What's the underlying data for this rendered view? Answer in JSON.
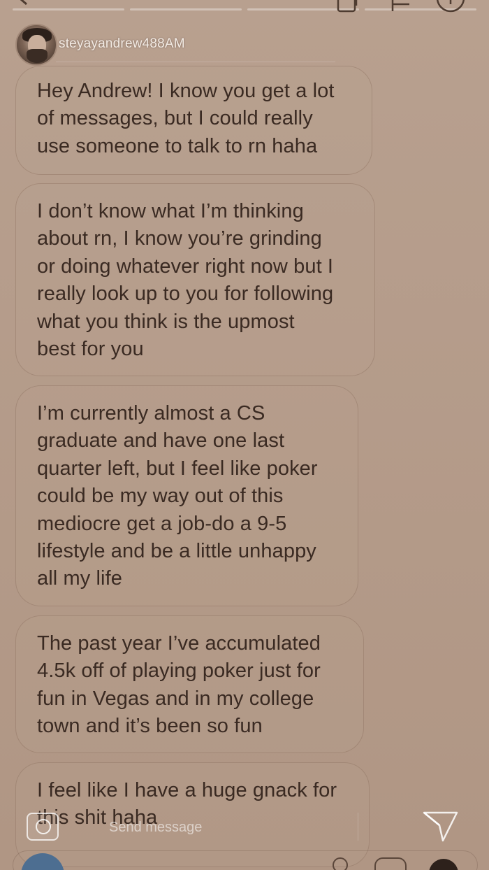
{
  "story": {
    "username": "steyayandrew488AM"
  },
  "messages": [
    {
      "text": "Hey Andrew! I know you get a lot\nof messages, but I could really\nuse someone to talk to rn haha"
    },
    {
      "text": "I don’t know what I’m thinking\nabout rn, I know you’re grinding\nor doing whatever right now but I\nreally look up to you for following\nwhat you think is the upmost\nbest for you"
    },
    {
      "text": "I’m currently almost a CS\ngraduate and have one last\nquarter left, but I feel like poker\ncould be my way out of this\nmediocre get a job-do a 9-5\nlifestyle and be a little unhappy\nall my life"
    },
    {
      "text": "The past year I’ve accumulated\n4.5k off of playing poker just for\nfun in Vegas and in my college\ntown and it’s been so fun"
    },
    {
      "text": "I feel like I have a huge gnack for\nthis shit haha"
    }
  ],
  "reply": {
    "placeholder": "Send message"
  },
  "icons": {
    "camera": "camera-icon",
    "send": "paper-plane-icon",
    "close": "close-icon",
    "more": "more-icon"
  },
  "colors": {
    "overlay_bg": "#b49a89",
    "bubble_text": "#3a2a22",
    "username_text": "#f3ebe4"
  }
}
